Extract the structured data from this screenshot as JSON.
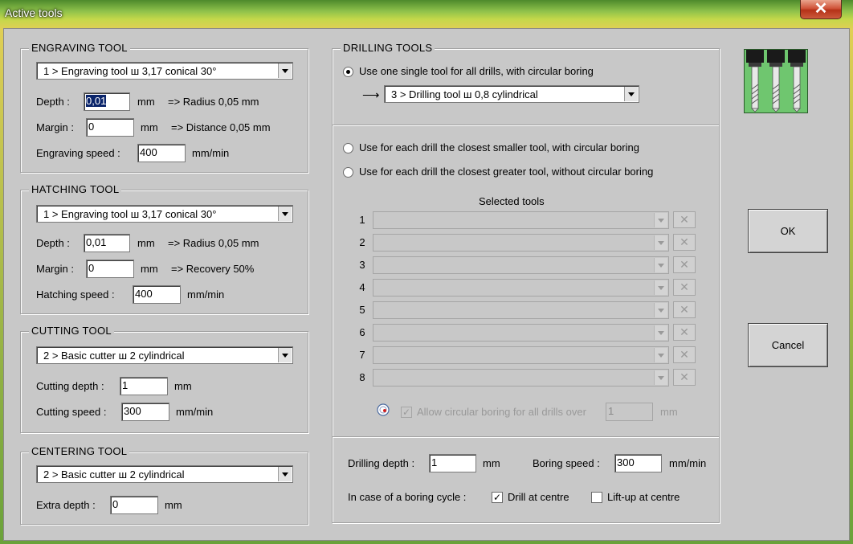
{
  "window": {
    "title": "Active tools",
    "close_symbol": "✕"
  },
  "engraving": {
    "legend": "ENGRAVING TOOL",
    "tool": "1 > Engraving tool   ш 3,17   conical 30°",
    "depth_label": "Depth :",
    "depth_value": "0,01",
    "depth_unit": "mm",
    "depth_info": "=> Radius 0,05 mm",
    "margin_label": "Margin :",
    "margin_value": "0",
    "margin_unit": "mm",
    "margin_info": "=> Distance 0,05 mm",
    "speed_label": "Engraving speed :",
    "speed_value": "400",
    "speed_unit": "mm/min"
  },
  "hatching": {
    "legend": "HATCHING TOOL",
    "tool": "1 > Engraving tool   ш 3,17   conical 30°",
    "depth_label": "Depth :",
    "depth_value": "0,01",
    "depth_unit": "mm",
    "depth_info": "=> Radius 0,05 mm",
    "margin_label": "Margin :",
    "margin_value": "0",
    "margin_unit": "mm",
    "margin_info": "=> Recovery 50%",
    "speed_label": "Hatching speed :",
    "speed_value": "400",
    "speed_unit": "mm/min"
  },
  "cutting": {
    "legend": "CUTTING TOOL",
    "tool": "2 > Basic cutter   ш 2   cylindrical",
    "depth_label": "Cutting depth :",
    "depth_value": "1",
    "depth_unit": "mm",
    "speed_label": "Cutting speed :",
    "speed_value": "300",
    "speed_unit": "mm/min"
  },
  "centering": {
    "legend": "CENTERING TOOL",
    "tool": "2 > Basic cutter   ш 2   cylindrical",
    "extra_label": "Extra depth :",
    "extra_value": "0",
    "extra_unit": "mm"
  },
  "drilling": {
    "legend": "DRILLING TOOLS",
    "option_single": "Use one single tool for all drills, with circular boring",
    "arrow": "⟶",
    "single_tool": "3 > Drilling tool   ш 0,8   cylindrical",
    "option_smaller": "Use for each drill the closest smaller tool, with circular boring",
    "option_greater": "Use for each drill the closest greater tool, without circular boring",
    "selected_tools_header": "Selected tools",
    "slots": [
      "1",
      "2",
      "3",
      "4",
      "5",
      "6",
      "7",
      "8"
    ],
    "clear_symbol": "✕",
    "allow_boring_label": "Allow circular boring for all drills over",
    "allow_boring_value": "1",
    "allow_boring_unit": "mm",
    "check_mark": "✓",
    "depth_label": "Drilling depth :",
    "depth_value": "1",
    "depth_unit": "mm",
    "boring_speed_label": "Boring speed :",
    "boring_speed_value": "300",
    "boring_speed_unit": "mm/min",
    "boring_cycle_label": "In case of a boring cycle :",
    "drill_centre_label": "Drill at centre",
    "liftup_centre_label": "Lift-up at centre"
  },
  "buttons": {
    "ok": "OK",
    "cancel": "Cancel"
  }
}
